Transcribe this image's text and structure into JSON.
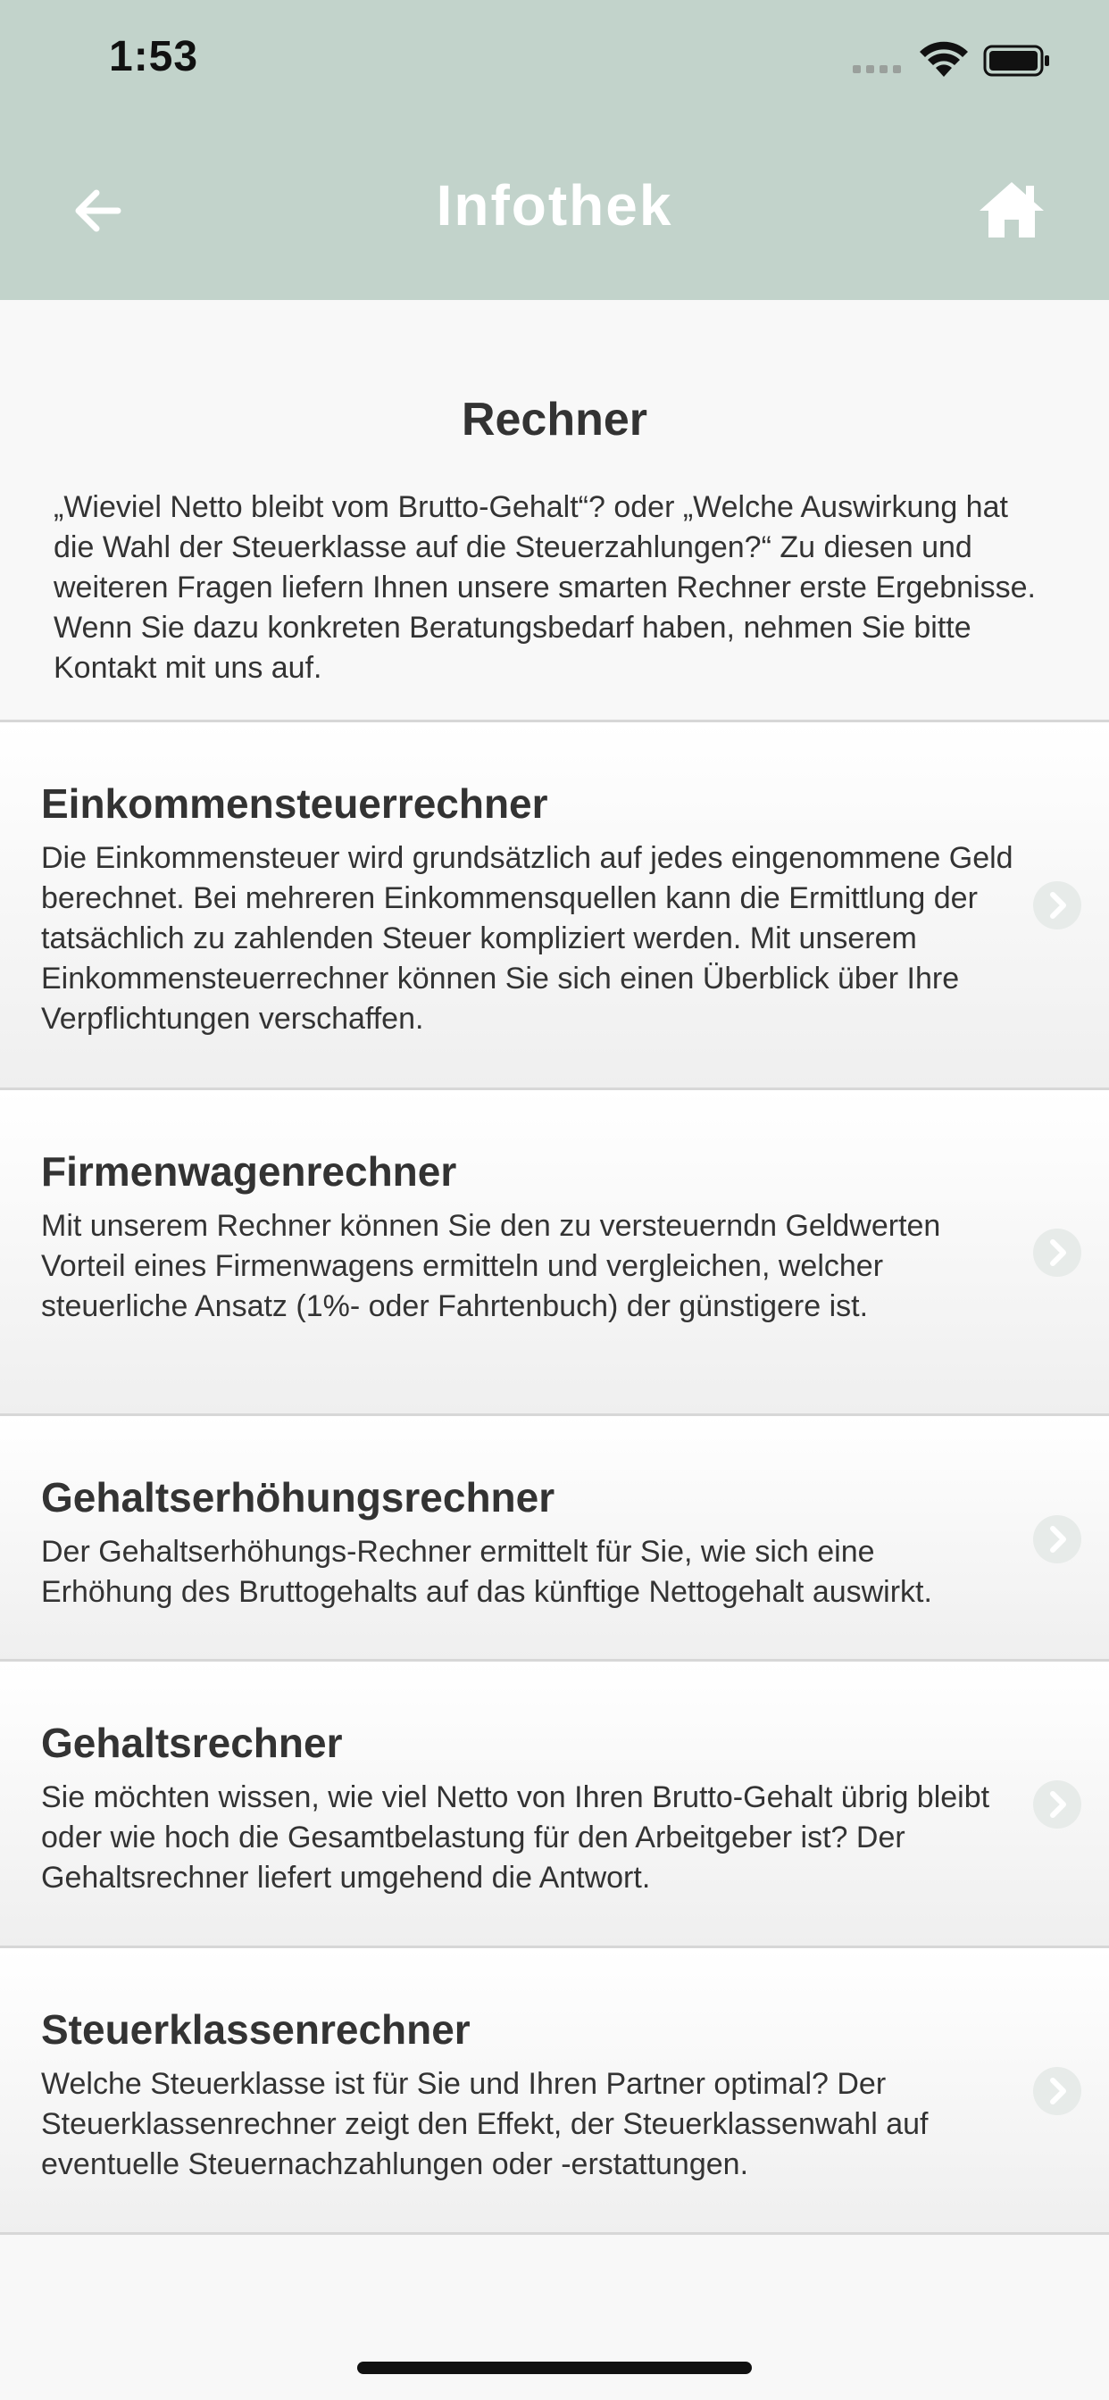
{
  "status_bar": {
    "time": "1:53"
  },
  "nav": {
    "title": "Infothek",
    "back_icon": "back-arrow-icon",
    "home_icon": "home-icon"
  },
  "intro": {
    "title": "Rechner",
    "text": "„Wieviel Netto bleibt vom Brutto-Gehalt“? oder „Welche Auswirkung hat die Wahl der Steuerklasse auf die Steuerzahlungen?“ Zu diesen und weiteren Fragen liefern Ihnen unsere smarten Rechner erste Ergebnisse. Wenn Sie dazu konkreten Beratungsbedarf haben, nehmen Sie bitte Kontakt mit uns auf."
  },
  "items": [
    {
      "title": "Einkommensteuerrechner",
      "description": "Die Einkommensteuer wird grundsätzlich auf jedes eingenommene Geld berechnet. Bei mehreren Einkommensquellen kann die Ermittlung der tatsächlich zu zahlenden Steuer kompliziert werden. Mit unserem Einkommensteuerrechner können Sie sich einen Überblick über Ihre Verpflichtungen verschaffen."
    },
    {
      "title": "Firmenwagenrechner",
      "description": "Mit unserem Rechner können Sie den zu versteuerndn Geldwerten Vorteil eines Firmenwagens ermitteln und vergleichen, welcher steuerliche Ansatz (1%- oder Fahrtenbuch) der günstigere ist."
    },
    {
      "title": "Gehaltserhöhungsrechner",
      "description": "Der Gehaltserhöhungs-Rechner ermittelt für Sie, wie sich eine Erhöhung des Bruttogehalts auf das künftige Nettogehalt auswirkt."
    },
    {
      "title": "Gehaltsrechner",
      "description": "Sie möchten wissen, wie viel Netto von Ihren Brutto-Gehalt übrig bleibt oder wie hoch die Gesamtbelastung für den Arbeitgeber ist? Der Gehaltsrechner liefert umgehend die Antwort."
    },
    {
      "title": "Steuerklassenrechner",
      "description": "Welche Steuerklasse ist für Sie und Ihren Partner optimal? Der Steuerklassenrechner zeigt den Effekt, der Steuerklassenwahl auf eventuelle Steuernachzahlungen oder -erstattungen."
    }
  ],
  "colors": {
    "header_bg": "#c2d3cb",
    "page_bg": "#f8f8f8",
    "text": "#333333",
    "chevron_bg": "#e7ebe9"
  }
}
